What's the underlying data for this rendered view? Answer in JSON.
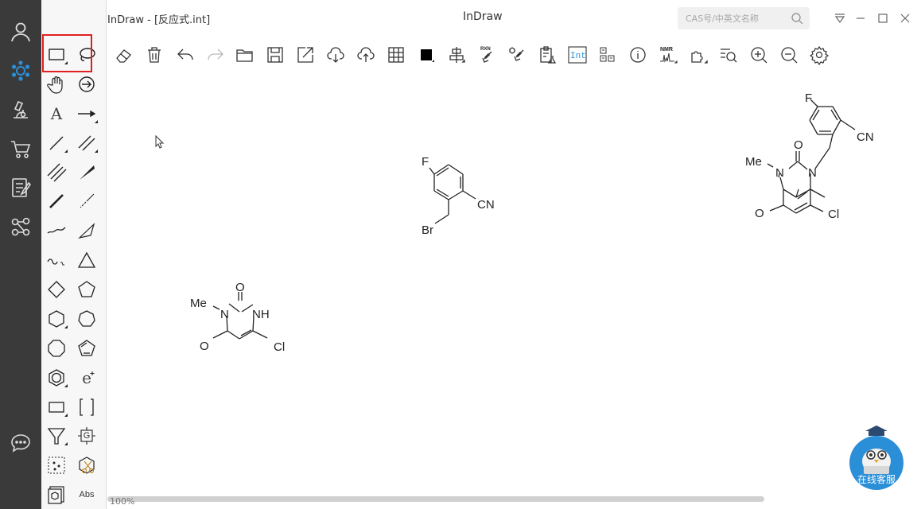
{
  "window": {
    "file_title": "InDraw - [反应式.int]",
    "app_title": "InDraw",
    "search_placeholder": "CAS号/中英文名称"
  },
  "left_nav": [
    "account-icon",
    "indraw-logo-icon",
    "microscope-icon",
    "cart-icon",
    "notes-icon",
    "molecule-network-icon",
    "chat-icon"
  ],
  "palette": {
    "text_tool": "A",
    "e_tool": "e",
    "abs_label": "Abs",
    "g_label": "G"
  },
  "toolbar": {
    "rxn_label": "RXN",
    "int_label": "Int",
    "nmr_label": "NMR"
  },
  "molecules": {
    "benzyl_bromide": {
      "F": "F",
      "CN": "CN",
      "Br": "Br"
    },
    "product": {
      "F": "F",
      "CN": "CN",
      "O_top": "O",
      "Me": "Me",
      "N1": "N",
      "N3": "N",
      "O_bottom": "O",
      "Cl": "Cl"
    },
    "uracil": {
      "O_top": "O",
      "Me": "Me",
      "N1": "N",
      "NH": "NH",
      "O_bottom": "O",
      "Cl": "Cl"
    }
  },
  "status": {
    "zoom": "100%"
  },
  "chat_bot": {
    "label": "在线客服"
  },
  "colors": {
    "nav_bg": "#3a3a3a",
    "highlight": "#e02020",
    "accent_blue": "#2b8fd8"
  }
}
